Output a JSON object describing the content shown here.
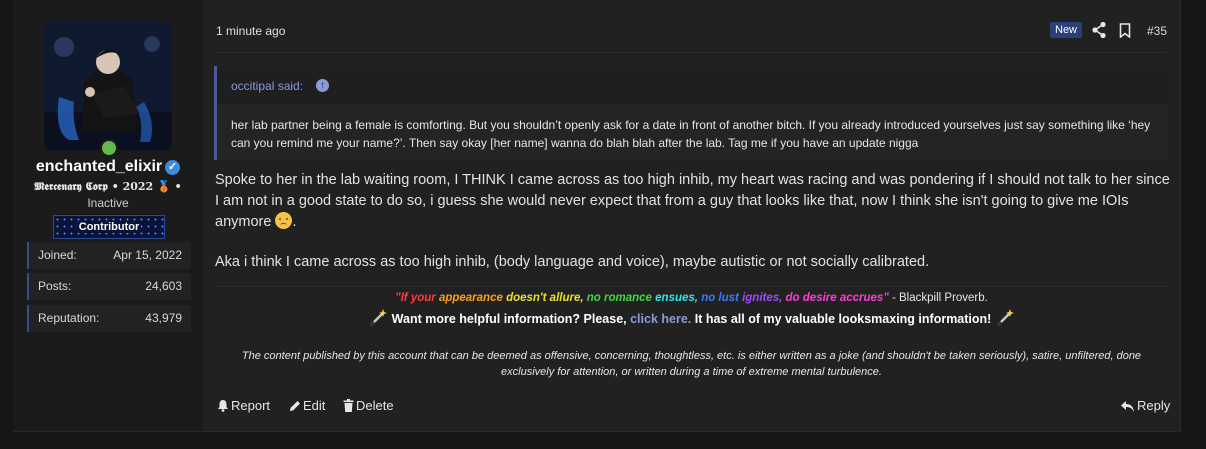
{
  "post": {
    "timestamp": "1 minute ago",
    "new_badge": "New",
    "post_number": "#35"
  },
  "user": {
    "username": "enchanted_elixir",
    "title": "𝕸𝖊𝖗𝖈𝖊𝖓𝖆𝖗𝖞 𝕮𝖔𝖗𝖕 • 2022 🥉 •",
    "status": "Inactive",
    "banner": "Contributor",
    "stats": [
      {
        "label": "Joined:",
        "value": "Apr 15, 2022"
      },
      {
        "label": "Posts:",
        "value": "24,603"
      },
      {
        "label": "Reputation:",
        "value": "43,979"
      }
    ]
  },
  "quote": {
    "author": "occitipal said:",
    "text": "her lab partner being a female is comforting. But you shouldn’t openly ask for a date in front of another bitch. If you already introduced yourselves just say something like ‘hey can you remind me your name?’. Then say okay [her name] wanna do blah blah after the lab. Tag me if you have an update nigga"
  },
  "body": {
    "paragraph1": "Spoke to her in the lab waiting room, I THINK I came across as too high inhib, my heart was racing and was pondering if I should not talk to her since I am not in a good state to do so, i guess she would never expect that from a guy that looks like that, now I think she isn't going to give me IOIs anymore",
    "paragraph1_end": ".",
    "paragraph2": "Aka i think I came across as too high inhib, (body language and voice), maybe autistic or not socially calibrated."
  },
  "signature": {
    "quote_parts": [
      "\"If your ",
      "appearance ",
      "doesn't allure, ",
      "no romance ",
      "ensues, ",
      "no lust ",
      "ignites, ",
      "do desire accrues\""
    ],
    "quote_suffix": " - Blackpill Proverb.",
    "info_prefix": "Want more helpful information? Please, ",
    "info_link": "click here.",
    "info_suffix": " It has all of my valuable looksmaxing information!",
    "disclaimer": "The content published by this account that can be deemed as offensive, concerning, thoughtless, etc. is either written as a joke (and shouldn't be taken seriously), satire, unfiltered, done exclusively for attention, or written during a time of extreme mental turbulence."
  },
  "actions": {
    "report": "Report",
    "edit": "Edit",
    "delete": "Delete",
    "reply": "Reply"
  }
}
